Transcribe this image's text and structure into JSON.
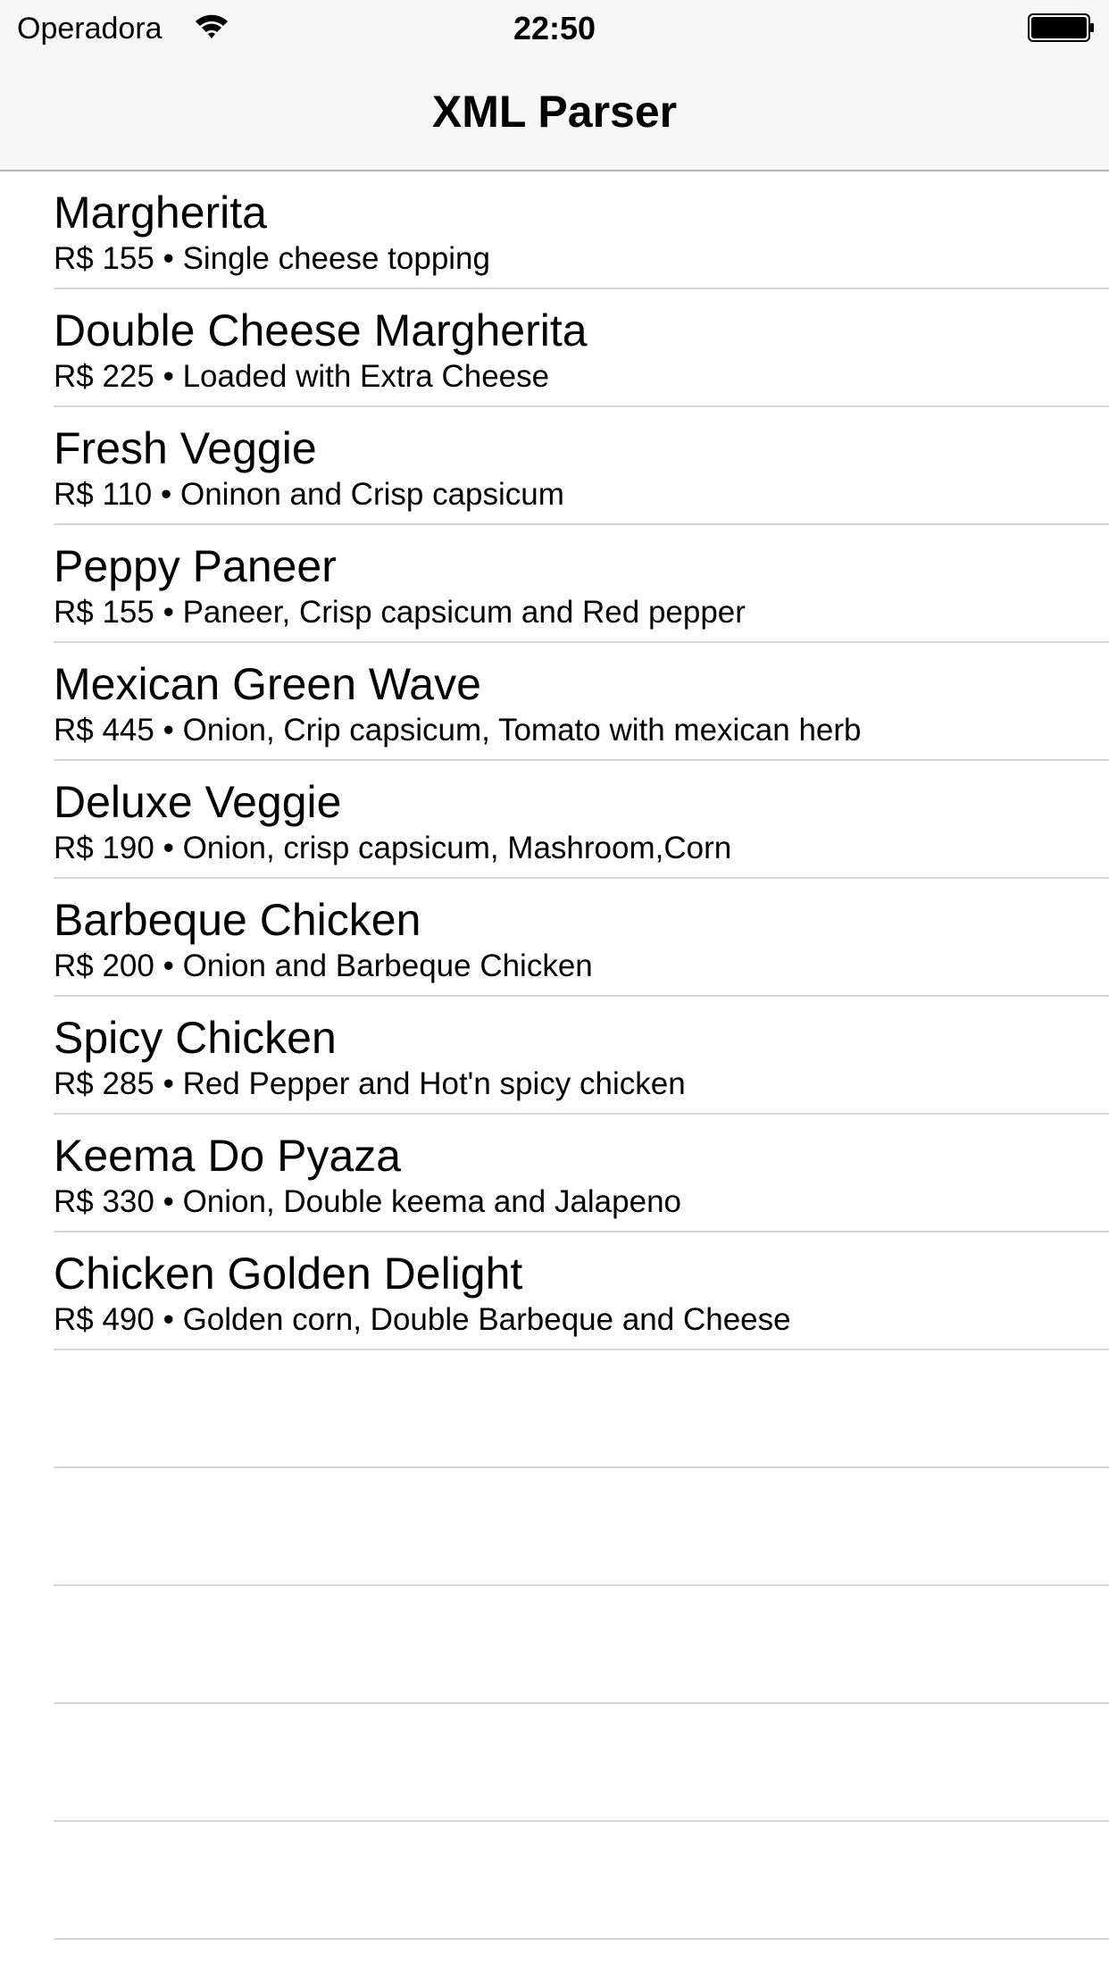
{
  "status_bar": {
    "carrier": "Operadora",
    "time": "22:50",
    "wifi_icon": "wifi-icon",
    "battery_icon": "battery-icon"
  },
  "nav": {
    "title": "XML Parser"
  },
  "items": [
    {
      "name": "Margherita",
      "detail": "R$ 155 • Single cheese topping"
    },
    {
      "name": "Double Cheese Margherita",
      "detail": "R$ 225 • Loaded with Extra Cheese"
    },
    {
      "name": "Fresh Veggie",
      "detail": "R$ 110 • Oninon and Crisp capsicum"
    },
    {
      "name": "Peppy Paneer",
      "detail": "R$ 155 • Paneer, Crisp capsicum and Red pepper"
    },
    {
      "name": "Mexican Green Wave",
      "detail": "R$ 445 • Onion, Crip capsicum, Tomato with mexican herb"
    },
    {
      "name": "Deluxe Veggie",
      "detail": "R$ 190 • Onion, crisp capsicum, Mashroom,Corn"
    },
    {
      "name": "Barbeque Chicken",
      "detail": "R$ 200 • Onion and Barbeque Chicken"
    },
    {
      "name": "Spicy Chicken",
      "detail": "R$ 285 • Red Pepper and Hot'n spicy chicken"
    },
    {
      "name": "Keema Do Pyaza",
      "detail": "R$ 330 • Onion, Double keema and Jalapeno"
    },
    {
      "name": "Chicken Golden Delight",
      "detail": "R$ 490 • Golden corn, Double Barbeque and Cheese"
    }
  ],
  "colors": {
    "nav_background": "#f7f7f7",
    "separator": "#d6d6d9",
    "text": "#000000"
  }
}
